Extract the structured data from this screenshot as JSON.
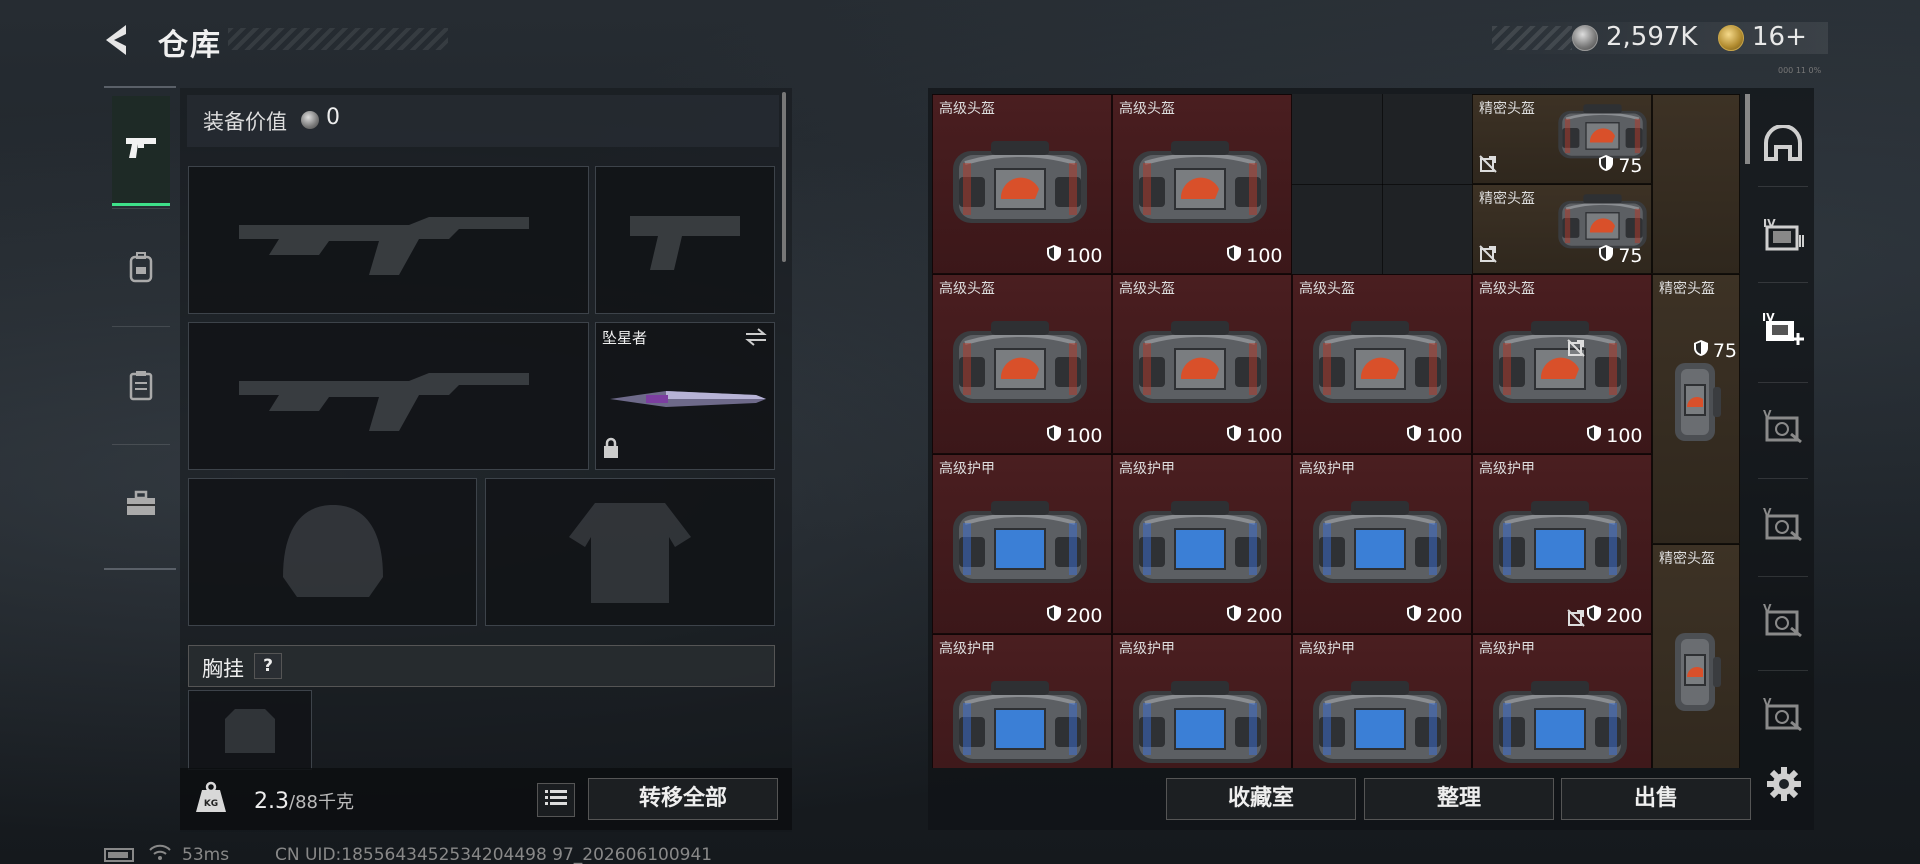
{
  "header": {
    "title": "仓库",
    "currency_silver": "2,597K",
    "currency_gold": "16+",
    "tiny_text": "000 11 0%"
  },
  "equipment": {
    "value_label": "装备价值",
    "value": "0",
    "melee_name": "坠星者",
    "chest_label": "胸挂",
    "help": "?",
    "weight_current": "2.3",
    "weight_max": "/88千克",
    "transfer_all": "转移全部"
  },
  "status": {
    "ping": "53ms",
    "uid": "CN UID:1855643452534204498 97_202606100941"
  },
  "storage": {
    "items": [
      {
        "name": "高级头盔",
        "durability": "100",
        "kind": "helmet",
        "tier": "red"
      },
      {
        "name": "高级头盔",
        "durability": "100",
        "kind": "helmet",
        "tier": "red"
      },
      {
        "name": "精密头盔",
        "durability": "75",
        "kind": "helmet",
        "tier": "gold"
      },
      {
        "name": "精密头盔",
        "durability": "75",
        "kind": "helmet",
        "tier": "gold"
      },
      {
        "name": "高级头盔",
        "durability": "100",
        "kind": "helmet",
        "tier": "red"
      },
      {
        "name": "高级头盔",
        "durability": "100",
        "kind": "helmet",
        "tier": "red"
      },
      {
        "name": "高级头盔",
        "durability": "100",
        "kind": "helmet",
        "tier": "red"
      },
      {
        "name": "高级头盔",
        "durability": "100",
        "kind": "helmet",
        "tier": "red"
      },
      {
        "name": "精密头盔",
        "durability": "75",
        "kind": "helmet",
        "tier": "gold"
      },
      {
        "name": "高级护甲",
        "durability": "200",
        "kind": "armor",
        "tier": "red"
      },
      {
        "name": "高级护甲",
        "durability": "200",
        "kind": "armor",
        "tier": "red"
      },
      {
        "name": "高级护甲",
        "durability": "200",
        "kind": "armor",
        "tier": "red"
      },
      {
        "name": "高级护甲",
        "durability": "200",
        "kind": "armor",
        "tier": "red"
      },
      {
        "name": "精密头盔",
        "durability": "",
        "kind": "helmet",
        "tier": "gold"
      },
      {
        "name": "高级护甲",
        "durability": "",
        "kind": "armor",
        "tier": "red"
      },
      {
        "name": "高级护甲",
        "durability": "",
        "kind": "armor",
        "tier": "red"
      },
      {
        "name": "高级护甲",
        "durability": "",
        "kind": "armor",
        "tier": "red"
      },
      {
        "name": "高级护甲",
        "durability": "",
        "kind": "armor",
        "tier": "red"
      }
    ],
    "buttons": {
      "collection": "收藏室",
      "organize": "整理",
      "sell": "出售"
    }
  },
  "colors": {
    "accent_green": "#3ee089",
    "item_red": "#4a1e20",
    "item_gold": "#3d3225",
    "helmet_emblem": "#d9502a",
    "armor_panel": "#3b7fd6"
  },
  "icons": {
    "left_tabs": [
      "pistol-icon",
      "backpack-icon",
      "vest-icon",
      "toolbox-icon"
    ],
    "right_rail": [
      "bunker-icon",
      "storage-case-icon",
      "add-case-icon",
      "case-icon",
      "case-icon",
      "case-icon",
      "case-icon"
    ]
  }
}
